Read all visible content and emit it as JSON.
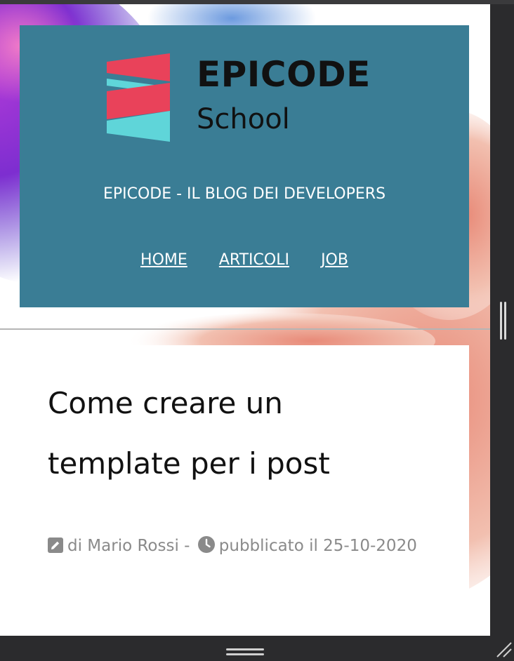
{
  "header": {
    "logo_word": "EPICODE",
    "logo_sub": "School",
    "tagline": "EPICODE - IL BLOG DEI DEVELOPERS",
    "nav": [
      "HOME",
      "ARTICOLI",
      "JOB"
    ]
  },
  "post": {
    "title_line1": "Come creare un",
    "title_line2": "template per i post",
    "author_text": "di Mario Rossi -",
    "published_text": "pubblicato il 25-10-2020"
  },
  "colors": {
    "header_bg": "#3a7d95",
    "logo_red": "#e9425a",
    "logo_cyan": "#5fd5d9",
    "page_bg": "#2b2b2d"
  },
  "icons": {
    "author": "pencil-square-icon",
    "published": "clock-icon"
  }
}
